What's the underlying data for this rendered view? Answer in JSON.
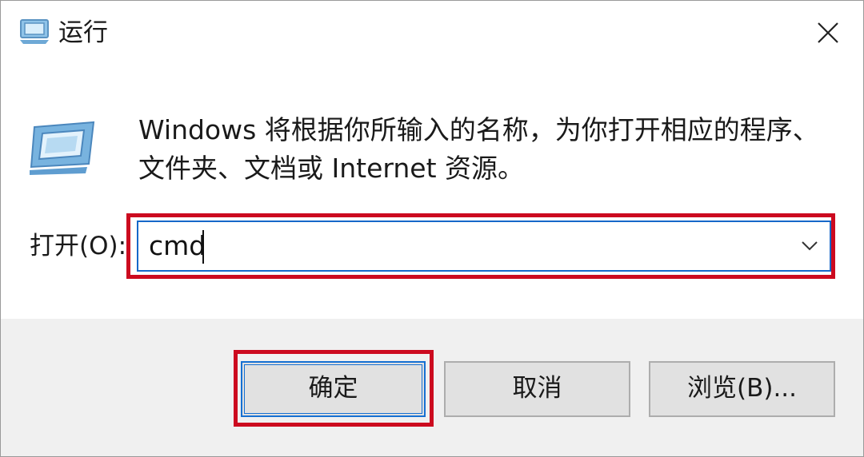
{
  "window": {
    "title": "运行",
    "title_icon": "run-dialog-icon",
    "close_icon": "close-icon"
  },
  "description": "Windows 将根据你所输入的名称，为你打开相应的程序、文件夹、文档或 Internet 资源。",
  "open": {
    "label": "打开(O):",
    "value": "cmd",
    "dropdown_icon": "chevron-down-icon"
  },
  "buttons": {
    "ok": "确定",
    "cancel": "取消",
    "browse": "浏览(B)..."
  },
  "colors": {
    "highlight": "#cc0a1f",
    "focus": "#1670d2",
    "footer_bg": "#f0f0f0"
  }
}
